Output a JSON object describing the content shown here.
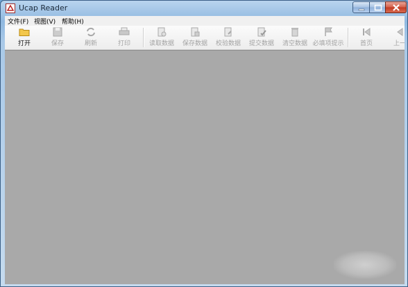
{
  "window": {
    "title": "Ucap Reader",
    "controls": [
      "minimize-icon",
      "maximize-icon",
      "close-icon"
    ]
  },
  "menubar": {
    "items": [
      "文件(F)",
      "视图(V)",
      "帮助(H)"
    ]
  },
  "toolbar": {
    "buttons": [
      {
        "label": "打开",
        "icon": "folder-open-icon",
        "enabled": true
      },
      {
        "label": "保存",
        "icon": "save-icon",
        "enabled": false
      },
      {
        "label": "刷新",
        "icon": "refresh-icon",
        "enabled": false
      },
      {
        "label": "打印",
        "icon": "print-icon",
        "enabled": false
      },
      {
        "label": "读取数据",
        "icon": "read-data-icon",
        "enabled": false
      },
      {
        "label": "保存数据",
        "icon": "save-data-icon",
        "enabled": false
      },
      {
        "label": "校验数据",
        "icon": "validate-data-icon",
        "enabled": false
      },
      {
        "label": "提交数据",
        "icon": "submit-data-icon",
        "enabled": false
      },
      {
        "label": "清空数据",
        "icon": "clear-data-icon",
        "enabled": false
      },
      {
        "label": "必填项提示",
        "icon": "required-flag-icon",
        "enabled": false
      },
      {
        "label": "首页",
        "icon": "first-page-icon",
        "enabled": false
      },
      {
        "label": "上一",
        "icon": "previous-page-icon",
        "enabled": false
      }
    ]
  },
  "colors": {
    "canvas": "#a9a9a9",
    "disabled_text": "#a3a3a3",
    "enabled_text": "#111111",
    "close_button": "#c13a22"
  }
}
